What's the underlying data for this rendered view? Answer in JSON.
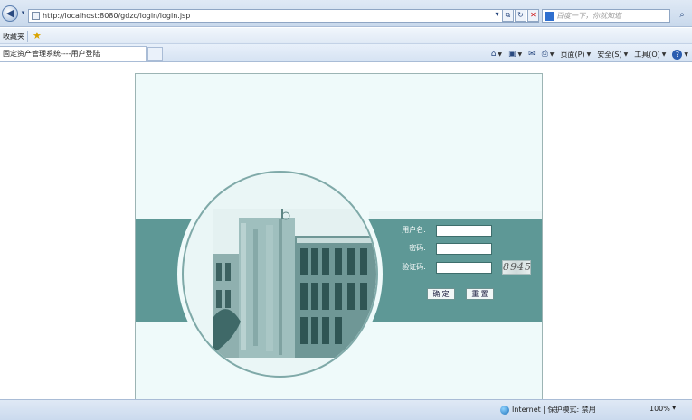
{
  "browser": {
    "url": "http://localhost:8080/gdzc/login/login.jsp",
    "search_placeholder": "百度一下，你就知道",
    "favorites_label": "收藏夹",
    "tab_title": "固定资产管理系统----用户登陆",
    "commands": {
      "page": "页面(P)",
      "safety": "安全(S)",
      "tools": "工具(O)"
    }
  },
  "icons": {
    "back": "back-arrow-icon",
    "page": "page-icon",
    "refresh": "refresh-icon",
    "stop": "stop-icon",
    "favorites_star": "star-icon",
    "home": "home-icon",
    "feeds": "rss-feed-icon",
    "mail": "mail-icon",
    "print": "print-icon",
    "help": "help-icon",
    "internet_zone": "globe-icon"
  },
  "login": {
    "username_label": "用户名:",
    "password_label": "密码:",
    "captcha_label": "验证码:",
    "captcha_value": "8945",
    "submit_label": "确 定",
    "reset_label": "重 置"
  },
  "status": {
    "zone": "Internet | 保护模式: 禁用",
    "zoom": "100%"
  },
  "colors": {
    "band": "#5e9896",
    "frame_bg": "#effafa",
    "chrome": "#dfe9f5"
  }
}
